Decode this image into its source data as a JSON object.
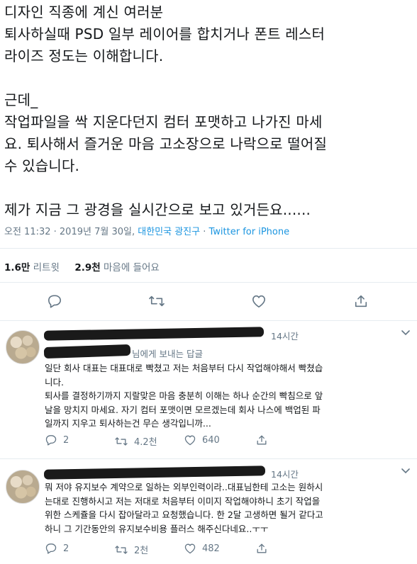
{
  "tweet": {
    "lines": [
      "디자인 직종에 계신 여러분",
      "퇴사하실때  PSD 일부 레이어를 합치거나 폰트 레스터",
      "라이즈 정도는 이해합니다.",
      "",
      "근데_",
      "작업파일을 싹 지운다던지 컴터 포맷하고 나가진 마세",
      "요. 퇴사해서 즐거운 마음 고소장으로 나락으로 떨어질",
      "수 있습니다.",
      "",
      "제가 지금 그 광경을 실시간으로 보고 있거든요......"
    ],
    "timestamp": "오전 11:32 · 2019년 7월 30일,",
    "location": "대한민국 광진구",
    "separator": " · ",
    "source": "Twitter for iPhone",
    "retweet_count": "1.6만",
    "retweet_label": "리트윗",
    "like_count": "2.9천",
    "like_label": "마음에 들어요"
  },
  "icons": {
    "reply": "reply-icon",
    "retweet": "retweet-icon",
    "like": "heart-icon",
    "share": "share-icon",
    "more": "chevron-down-icon"
  },
  "replies": [
    {
      "time": "14시간",
      "reply_to_suffix": "님에게 보내는 답글",
      "lines": [
        "일단 회사 대표는 대표대로 빡쳤고 저는 처음부터 다시 작업해야해서 빡쳤습",
        "니다.",
        "퇴사를 결정하기까지 지랄맞은 마음 충분히 이해는 하나 순간의 빡침으로 앞",
        "날을 망치지 마세요. 자기 컴터 포맷이면 모르겠는데 회사 나스에 백업된 파",
        "일까지 지우고 퇴사하는건 무슨 생각입니까..."
      ],
      "reply_count": "2",
      "retweet_count": "4.2천",
      "like_count": "640"
    },
    {
      "time": "14시간",
      "lines": [
        "뭐 저야 유지보수 계약으로 일하는 외부인력이라..대표님한테 고소는 원하시",
        "는대로 진행하시고 저는 저대로 처음부터 이미지 작업해야하니 초기 작업을",
        "위한 스케쥴을 다시 잡아달라고 요청했습니다. 한 2달 고생하면 될거 같다고",
        "하니 그 기간동안의 유지보수비용 플러스 해주신다네요..ㅜㅜ"
      ],
      "reply_count": "2",
      "retweet_count": "2천",
      "like_count": "482"
    }
  ]
}
